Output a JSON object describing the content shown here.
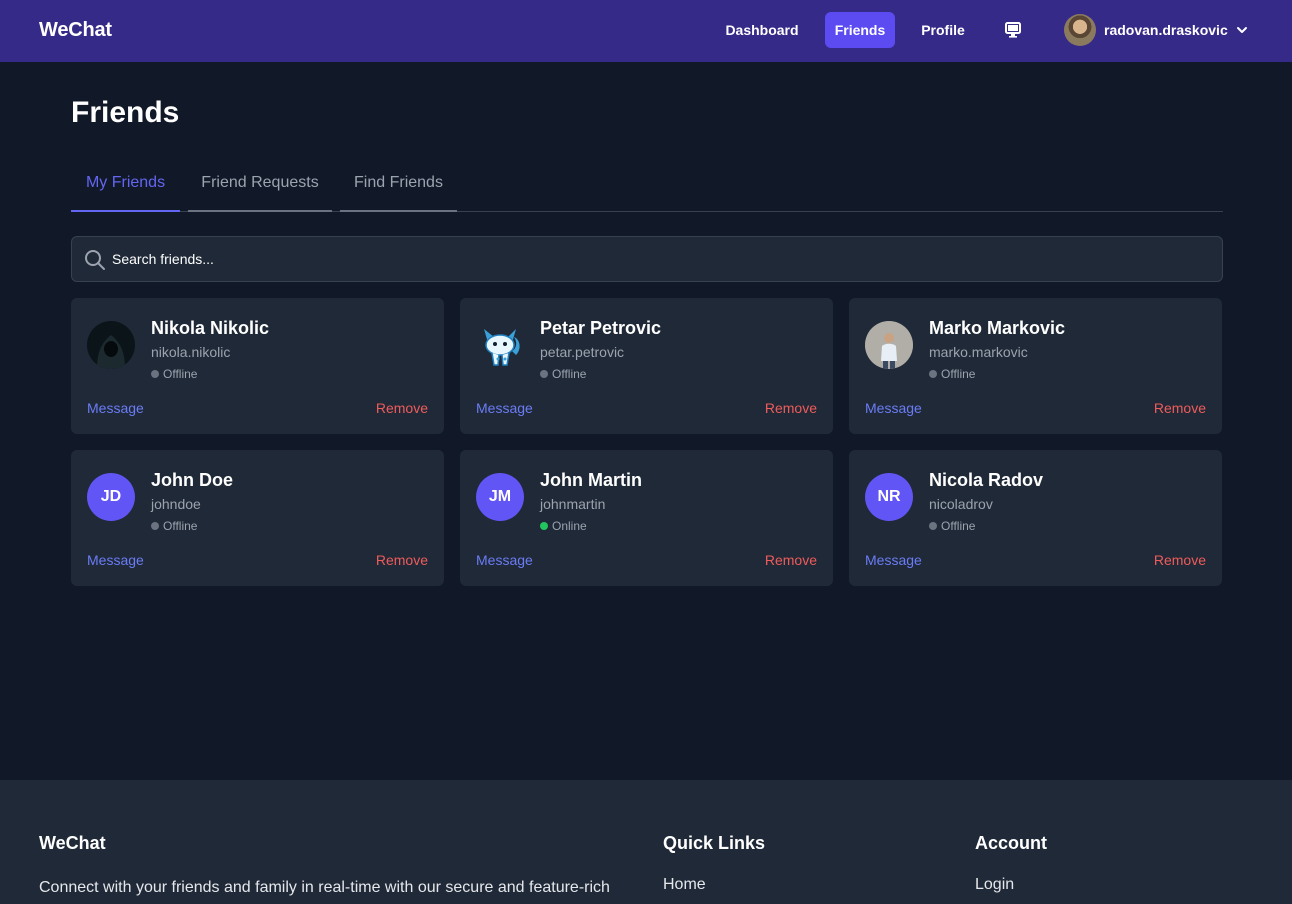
{
  "nav": {
    "brand": "WeChat",
    "links": [
      "Dashboard",
      "Friends",
      "Profile"
    ],
    "active": "Friends",
    "username": "radovan.draskovic"
  },
  "page": {
    "title": "Friends",
    "tabs": [
      "My Friends",
      "Friend Requests",
      "Find Friends"
    ],
    "search_placeholder": "Search friends..."
  },
  "friends": [
    {
      "name": "Nikola Nikolic",
      "username": "nikola.nikolic",
      "status": "Offline",
      "avatar": "hooded-figure-photo",
      "message": "Message",
      "remove": "Remove"
    },
    {
      "name": "Petar Petrovic",
      "username": "petar.petrovic",
      "status": "Offline",
      "avatar": "fox-mascot-image",
      "message": "Message",
      "remove": "Remove"
    },
    {
      "name": "Marko Markovic",
      "username": "marko.markovic",
      "status": "Offline",
      "avatar": "person-photo",
      "message": "Message",
      "remove": "Remove"
    },
    {
      "name": "John Doe",
      "username": "johndoe",
      "status": "Offline",
      "initials": "JD",
      "message": "Message",
      "remove": "Remove"
    },
    {
      "name": "John Martin",
      "username": "johnmartin",
      "status": "Online",
      "initials": "JM",
      "message": "Message",
      "remove": "Remove"
    },
    {
      "name": "Nicola Radov",
      "username": "nicoladrov",
      "status": "Offline",
      "initials": "NR",
      "message": "Message",
      "remove": "Remove"
    }
  ],
  "footer": {
    "brand": "WeChat",
    "description": "Connect with your friends and family in real-time with our secure and feature-rich",
    "quick_links_heading": "Quick Links",
    "quick_links": [
      "Home"
    ],
    "account_heading": "Account",
    "account_links": [
      "Login"
    ]
  },
  "colors": {
    "navbar": "#362a88",
    "accent": "#5b4bf0",
    "background": "#111827",
    "card": "#1f2937",
    "online": "#22c55e",
    "remove": "#ef5b5b"
  }
}
